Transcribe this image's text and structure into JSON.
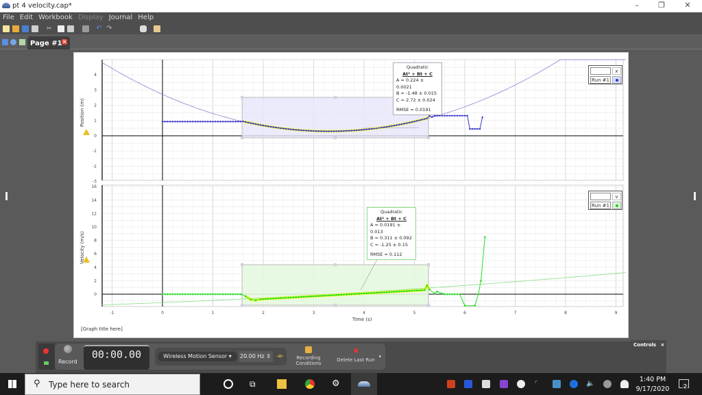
{
  "window": {
    "title": "pt 4 velocity.cap*",
    "minimize_icon": "minimize-icon",
    "restore_icon": "restore-icon",
    "close_icon": "close-icon"
  },
  "menu": {
    "items": [
      {
        "label": "File",
        "enabled": true
      },
      {
        "label": "Edit",
        "enabled": true
      },
      {
        "label": "Workbook",
        "enabled": true
      },
      {
        "label": "Display",
        "enabled": false
      },
      {
        "label": "Journal",
        "enabled": true
      },
      {
        "label": "Help",
        "enabled": true
      }
    ]
  },
  "toolbar": {
    "icons": [
      "new-file-icon",
      "open-folder-icon",
      "save-icon",
      "print-icon",
      "cut-icon",
      "copy-icon",
      "paste-icon",
      "screen-icon",
      "undo-icon",
      "redo-icon",
      "camera-icon",
      "grid-icon"
    ]
  },
  "tabs": {
    "page_tab_label": "Page #1",
    "close_label": "×"
  },
  "graph": {
    "title_placeholder": "[Graph title here]",
    "x_axis_label": "Time (s)",
    "x_ticks": [
      "-1",
      "0",
      "1",
      "2",
      "3",
      "4",
      "5",
      "6",
      "7",
      "8",
      "9"
    ],
    "colors": {
      "position_series": "#3333cc",
      "velocity_series": "#22dd22",
      "fit_highlight": "#ffff00",
      "position_selection": "#e6e6fa",
      "velocity_selection": "#e6f8e0"
    },
    "position": {
      "y_axis_label": "Position (m)",
      "y_ticks": [
        "4",
        "3",
        "2",
        "1",
        "0",
        "-1",
        "-2",
        "-3"
      ],
      "legend": {
        "column_symbol": "x",
        "run_label": "Run #1"
      },
      "fit": {
        "type": "Quadratic",
        "equation": "At² + Bt + C",
        "A": "A = 0.224 ± 0.0021",
        "B": "B = -1.48  ± 0.015",
        "C": "C = 2.72  ± 0.024",
        "rmse": "RMSE = 0.0191"
      }
    },
    "velocity": {
      "y_axis_label": "Velocity (m/s)",
      "y_ticks": [
        "16",
        "14",
        "12",
        "10",
        "8",
        "6",
        "4",
        "2",
        "0"
      ],
      "legend": {
        "column_symbol": "v",
        "run_label": "Run #1"
      },
      "fit": {
        "type": "Quadratic",
        "equation": "At² + Bt + C",
        "A": "A = 0.0191 ± 0.013",
        "B": "B = 0.311  ± 0.092",
        "C": "C = -1.25  ± 0.15",
        "rmse": "RMSE = 0.112"
      }
    }
  },
  "controls": {
    "record_label": "Record",
    "timer": "00:00.00",
    "sensor": "Wireless Motion Sensor",
    "rate": "20.00 Hz",
    "recording_conditions": "Recording Conditions",
    "delete_last_run": "Delete Last Run",
    "controls_panel_label": "Controls",
    "controls_close": "×"
  },
  "taskbar": {
    "search_placeholder": "Type here to search",
    "time": "1:40 PM",
    "date": "9/17/2020",
    "notification_count": "2"
  }
}
